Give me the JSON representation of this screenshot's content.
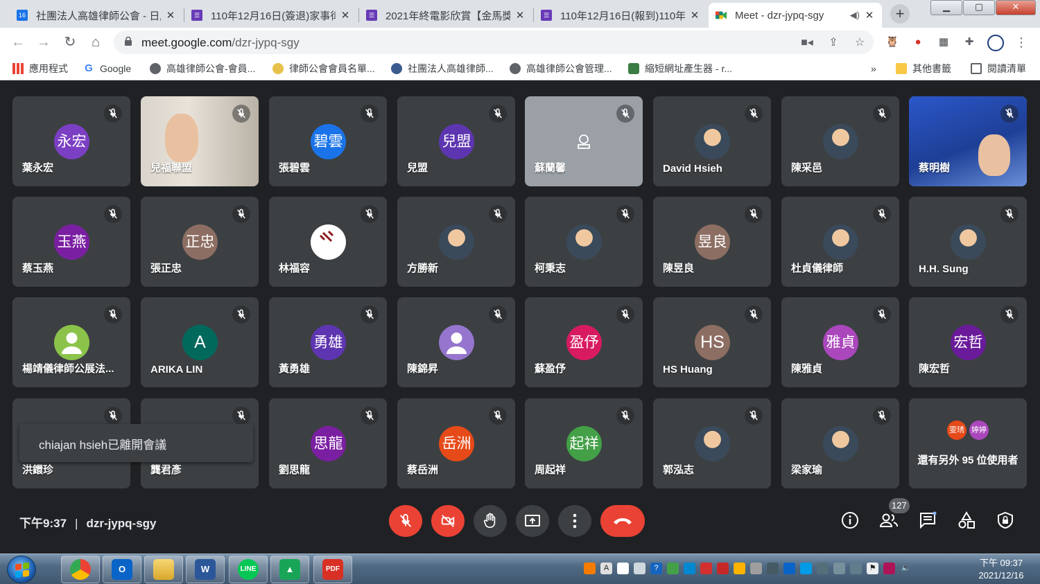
{
  "browser": {
    "tabs": [
      {
        "title": "社團法人高雄律師公會 - 日曆",
        "favicon": "calendar-icon",
        "badge": "16"
      },
      {
        "title": "110年12月16日(簽退)家事律",
        "favicon": "forms-icon"
      },
      {
        "title": "2021年終電影欣賞【金馬獎",
        "favicon": "forms-icon"
      },
      {
        "title": "110年12月16日(報到)110年",
        "favicon": "forms-icon"
      },
      {
        "title": "Meet - dzr-jypq-sgy",
        "favicon": "meet-icon"
      }
    ],
    "new_tab_symbol": "+",
    "window_controls": {
      "minimize": "▁",
      "maximize": "▢",
      "close": "✕"
    },
    "url": {
      "host": "meet.google.com",
      "path": "/dzr-jypq-sgy"
    },
    "bookmarks": [
      "應用程式",
      "Google",
      "高雄律師公會-會員...",
      "律師公會會員名單...",
      "社團法人高雄律師...",
      "高雄律師公會管理...",
      "縮短網址產生器 - r..."
    ],
    "bookmarks_overflow": "»",
    "other_bookmarks": "其他書籤",
    "reading_list": "閱讀清單"
  },
  "meet": {
    "participants": [
      {
        "name": "葉永宏",
        "initials": "永宏",
        "color": "#7b3fc4"
      },
      {
        "name": "兒福聯盟",
        "video": "video-feed"
      },
      {
        "name": "張碧雲",
        "initials": "碧雲",
        "color": "#1a73e8"
      },
      {
        "name": "兒盟",
        "initials": "兒盟",
        "color": "#5e35b1"
      },
      {
        "name": "蘇蘭馨",
        "video": "camera-off"
      },
      {
        "name": "David Hsieh",
        "photo": "profile-photo"
      },
      {
        "name": "陳采邑",
        "photo": "profile-photo"
      },
      {
        "name": "蔡明樹",
        "video": "video-feed",
        "speaking": true
      },
      {
        "name": "蔡玉燕",
        "initials": "玉燕",
        "color": "#7b1fa2"
      },
      {
        "name": "張正忠",
        "initials": "正忠",
        "color": "#8d6e63"
      },
      {
        "name": "林福容",
        "photo": "law-logo"
      },
      {
        "name": "方勝新",
        "photo": "profile-photo"
      },
      {
        "name": "柯秉志",
        "photo": "profile-photo"
      },
      {
        "name": "陳昱良",
        "initials": "昱良",
        "color": "#8d6e63"
      },
      {
        "name": "杜貞儀律師",
        "photo": "profile-photo"
      },
      {
        "name": "H.H. Sung",
        "photo": "profile-photo"
      },
      {
        "name": "楊靖儀律師公展法...",
        "photo": "default-person"
      },
      {
        "name": "ARIKA LIN",
        "initials": "A",
        "color": "#00695c"
      },
      {
        "name": "黃勇雄",
        "initials": "勇雄",
        "color": "#5e35b1"
      },
      {
        "name": "陳錦昇",
        "photo": "default-person-purple"
      },
      {
        "name": "蘇盈伃",
        "initials": "盈伃",
        "color": "#d81b60"
      },
      {
        "name": "HS Huang",
        "initials": "HS",
        "color": "#8d6e63"
      },
      {
        "name": "陳雅貞",
        "initials": "雅貞",
        "color": "#ab47bc"
      },
      {
        "name": "陳宏哲",
        "initials": "宏哲",
        "color": "#6a1b9a"
      },
      {
        "name": "洪鐶珍",
        "photo": "profile-photo"
      },
      {
        "name": "龔君彥",
        "photo": "none"
      },
      {
        "name": "劉思龍",
        "initials": "思龍",
        "color": "#7b1fa2"
      },
      {
        "name": "蔡岳洲",
        "initials": "岳洲",
        "color": "#e64a19"
      },
      {
        "name": "周起祥",
        "initials": "起祥",
        "color": "#43a047"
      },
      {
        "name": "郭泓志",
        "photo": "profile-photo"
      },
      {
        "name": "梁家瑜",
        "photo": "profile-photo"
      }
    ],
    "more_tile": {
      "avatars": [
        {
          "initials": "雯琇",
          "color": "#e64a19"
        },
        {
          "initials": "婷婷",
          "color": "#ab47bc"
        }
      ],
      "text": "還有另外 95 位使用者"
    },
    "toast": "chiajan hsieh已離開會議",
    "time": "下午9:37",
    "separator": "|",
    "meeting_code": "dzr-jypq-sgy",
    "participant_count": "127",
    "controls": {
      "mic": "mic-off-icon",
      "camera": "camera-off-icon",
      "raise_hand": "hand-icon",
      "present": "present-icon",
      "more": "more-vert-icon",
      "leave": "call-end-icon"
    },
    "right_controls": [
      "info-icon",
      "people-icon",
      "chat-icon",
      "activities-icon",
      "host-controls-icon"
    ]
  },
  "taskbar": {
    "apps": [
      "chrome",
      "outlook",
      "explorer",
      "word",
      "line",
      "image-viewer",
      "pdf"
    ],
    "app_labels": {
      "outlook": "O",
      "word": "W",
      "line": "LINE",
      "pdf": "PDF"
    },
    "clock_time": "下午 09:37",
    "clock_date": "2021/12/16"
  }
}
